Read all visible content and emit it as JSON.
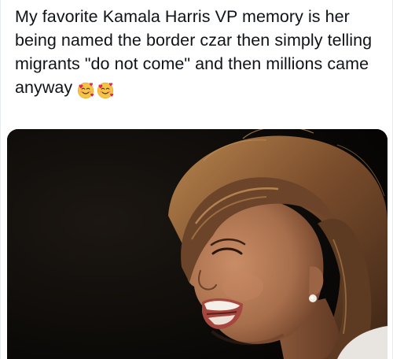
{
  "post": {
    "text": "My favorite Kamala Harris VP memory is her being named the border czar then simply telling migrants \"do not come\" and then millions came anyway",
    "emojis": [
      "smiling-face-with-hearts-icon",
      "smiling-face-with-hearts-icon"
    ]
  },
  "media": {
    "alt_subject": "photo-of-laughing-woman",
    "colors": {
      "background": "#0c0a08",
      "hair": "#6b4429",
      "hair_highlight": "#b9864f",
      "skin": "#b27a57",
      "skin_shadow": "#7c4c31",
      "lips": "#a5473e",
      "teeth": "#f4efe7",
      "shirt": "#e8e4df"
    }
  }
}
